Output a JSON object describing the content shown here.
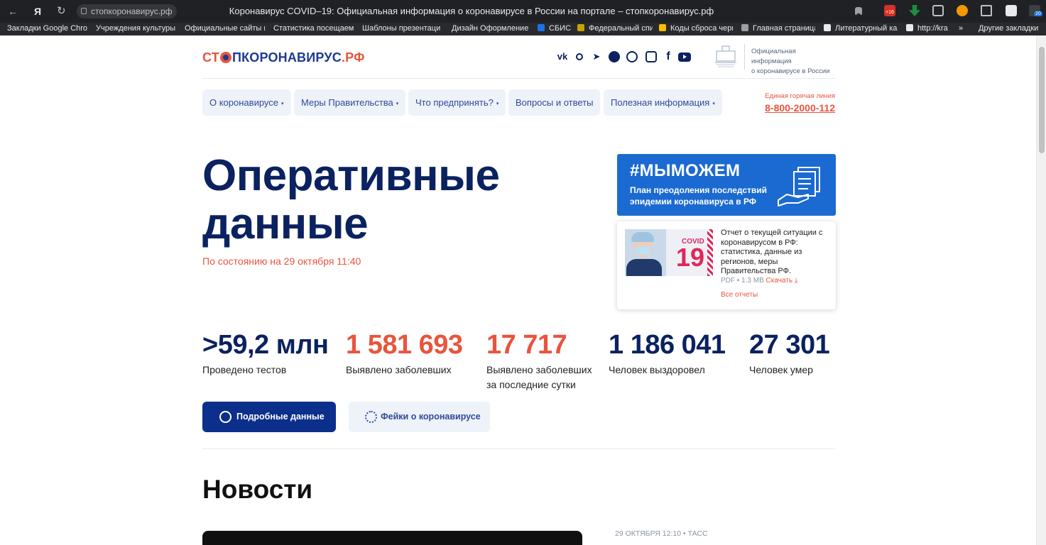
{
  "browser": {
    "url": "стопкоронавирус.рф",
    "tab_title": "Коронавирус COVID–19: Официальная информация о коронавирусе в России на портале – стопкоронавирус.рф",
    "nav": {
      "back": "←",
      "yandex": "Я",
      "reload": "↻"
    },
    "ext_badges": {
      "badge1": "+16",
      "badge2": "20"
    },
    "bookmarks": [
      "Закладки Google Chro",
      "Учреждения культуры",
      "Официальные сайты п",
      "Статистика посещаем",
      "Шаблоны презентаци",
      "Дизайн Оформление",
      "СБИС",
      "Федеральный спи",
      "Коды сброса черн",
      "Главная страница",
      "Литературный ка",
      "http://kra"
    ],
    "more": "»",
    "other_bookmarks": "Другие закладки"
  },
  "site": {
    "logo_pre": "СТ",
    "logo_post": "ПКОРОНАВИРУС",
    "logo_tld": ".РФ",
    "socials": [
      "vk",
      "ok",
      "telegram",
      "messenger",
      "viber",
      "instagram",
      "facebook",
      "youtube"
    ],
    "gov_text_1": "Официальная информация",
    "gov_text_2": "о коронавирусе в России",
    "menu": [
      "О коронавирусе",
      "Меры Правительства",
      "Что предпринять?",
      "Вопросы и ответы",
      "Полезная информация"
    ],
    "caret": "▾",
    "hotline_label": "Единая горячая линия",
    "hotline_number": "8-800-2000-112"
  },
  "hero": {
    "title_line1": "Оперативные",
    "title_line2": "данные",
    "as_of": "По состоянию на 29 октября 11:40"
  },
  "banner": {
    "tag": "#МЫМОЖЕМ",
    "subtitle": "План преодоления последствий эпидемии коронавируса в РФ"
  },
  "report": {
    "covid": "COVID",
    "covid_num": "19",
    "text": "Отчет о текущей ситуации с коронавирусом в РФ: статистика, данные из регионов, меры Правительства РФ.",
    "meta": "PDF • 1.3 MB",
    "download": "Скачать",
    "download_icon": "⤓",
    "all_reports": "Все отчеты"
  },
  "stats": [
    {
      "value": ">59,2 млн",
      "label": "Проведено тестов",
      "label2": ""
    },
    {
      "value": "1 581 693",
      "label": "Выявлено заболевших",
      "label2": ""
    },
    {
      "value": "17 717",
      "label": "Выявлено заболевших",
      "label2": "за последние сутки"
    },
    {
      "value": "1 186 041",
      "label": "Человек выздоровел",
      "label2": ""
    },
    {
      "value": "27 301",
      "label": "Человек умер",
      "label2": ""
    }
  ],
  "buttons": {
    "details": "Подробные данные",
    "fakes": "Фейки о коронавирусе"
  },
  "news": {
    "heading": "Новости",
    "meta": "29 ОКТЯБРЯ 12:10 • ТАСС"
  },
  "colors": {
    "navy": "#0b2260",
    "accent_red": "#e8553d",
    "banner_blue": "#1b6ad1",
    "menu_bg": "#eef2f9"
  }
}
